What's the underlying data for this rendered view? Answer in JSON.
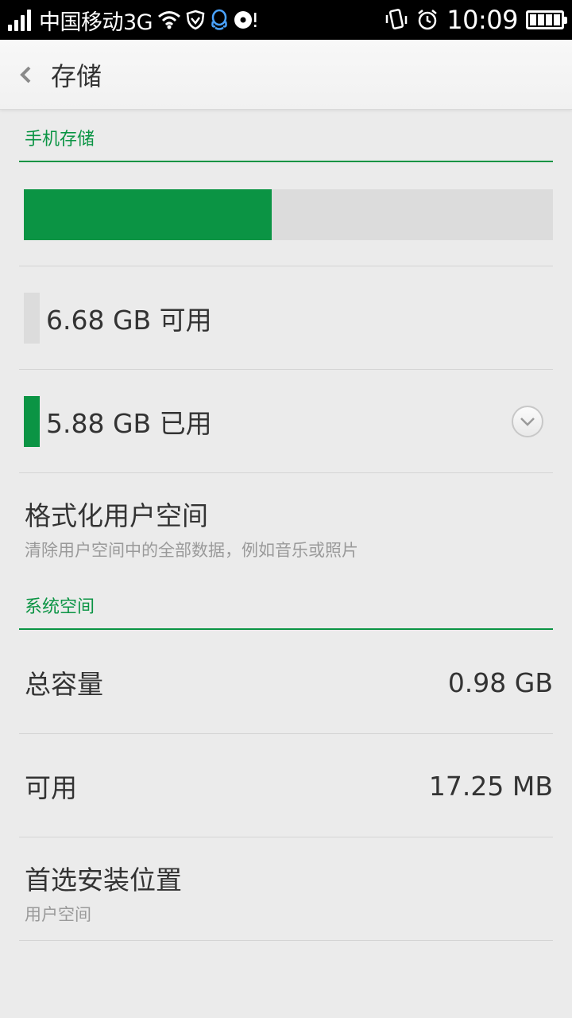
{
  "status_bar": {
    "carrier": "中国移动3G",
    "time": "10:09",
    "icons": [
      "signal-icon",
      "wifi-icon",
      "shield-icon",
      "qq-icon",
      "music-icon",
      "vibrate-icon",
      "alarm-icon",
      "battery-icon"
    ]
  },
  "header": {
    "back_icon": "chevron-left-icon",
    "title": "存储"
  },
  "phone_storage": {
    "section_title": "手机存储",
    "used_fraction": 0.468,
    "available_label": "6.68 GB 可用",
    "used_label": "5.88 GB 已用",
    "expand_icon": "chevron-down-icon"
  },
  "format": {
    "title": "格式化用户空间",
    "subtitle": "清除用户空间中的全部数据，例如音乐或照片"
  },
  "system_space": {
    "section_title": "系统空间",
    "total_label": "总容量",
    "total_value": "0.98 GB",
    "available_label": "可用",
    "available_value": "17.25 MB"
  },
  "install_location": {
    "title": "首选安装位置",
    "value": "用户空间"
  },
  "colors": {
    "accent": "#0b9444",
    "bar_background": "#dcdcdc",
    "page_background": "#ebebeb"
  }
}
